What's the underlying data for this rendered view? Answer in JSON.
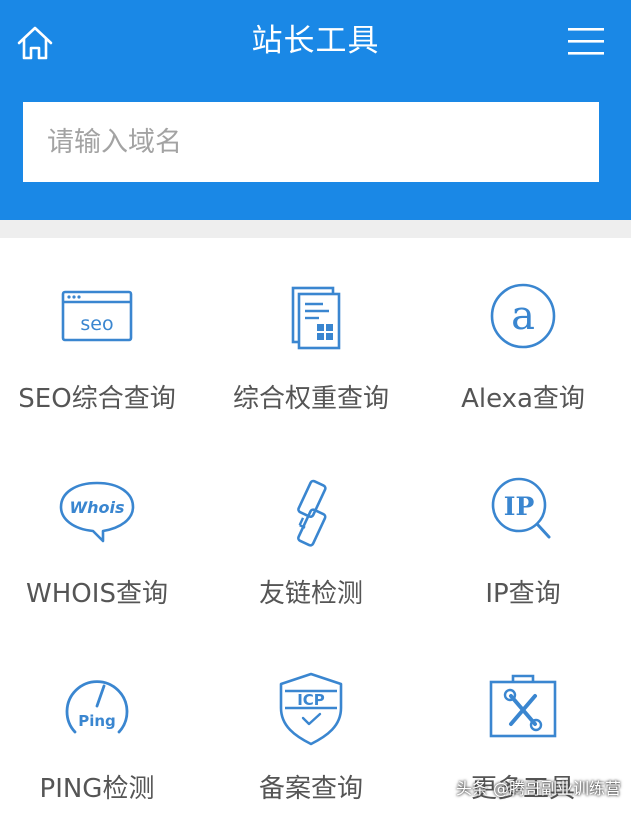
{
  "header": {
    "title": "站长工具",
    "search_placeholder": "请输入域名"
  },
  "colors": {
    "brand": "#1a88e6",
    "icon": "#3a86d0",
    "label": "#555555"
  },
  "tools": [
    {
      "label": "SEO综合查询",
      "icon": "seo-browser-icon"
    },
    {
      "label": "综合权重查询",
      "icon": "document-grid-icon"
    },
    {
      "label": "Alexa查询",
      "icon": "alexa-a-icon"
    },
    {
      "label": "WHOIS查询",
      "icon": "whois-bubble-icon"
    },
    {
      "label": "友链检测",
      "icon": "chain-link-icon"
    },
    {
      "label": "IP查询",
      "icon": "ip-magnifier-icon"
    },
    {
      "label": "PING检测",
      "icon": "ping-gauge-icon"
    },
    {
      "label": "备案查询",
      "icon": "icp-shield-icon"
    },
    {
      "label": "更多工具",
      "icon": "toolbox-icon"
    }
  ],
  "icon_text": {
    "seo": "seo",
    "whois": "Whois",
    "ip": "IP",
    "ping": "Ping",
    "icp": "ICP",
    "alexa": "a"
  },
  "watermark": "头条 @腾哥副业训练营"
}
